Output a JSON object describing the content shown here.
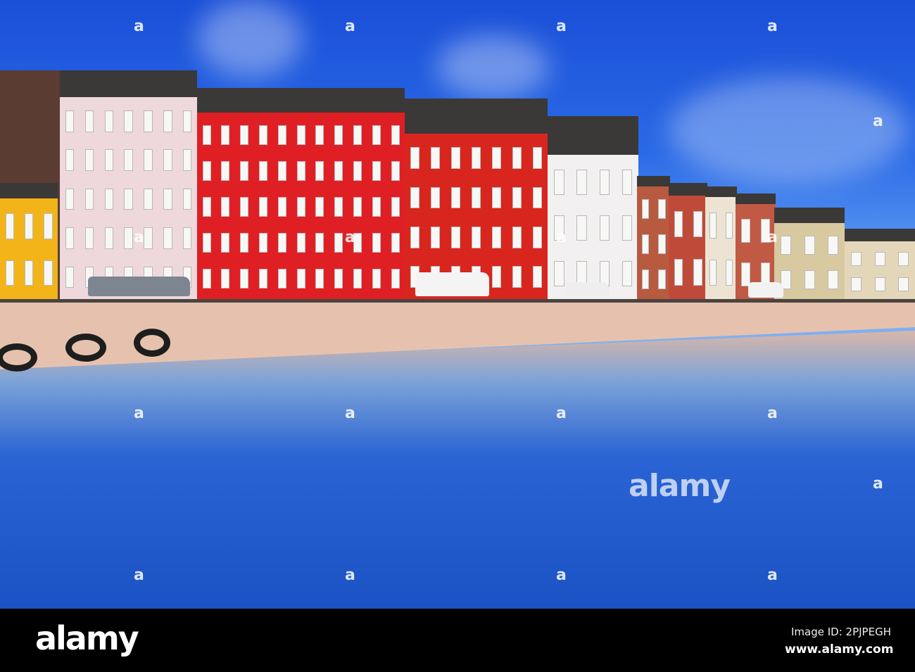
{
  "watermark": {
    "logo": "alamy",
    "center_text": "alamy",
    "tile_mark": "a"
  },
  "footer": {
    "logo": "alamy",
    "image_id": "Image ID: 2PJPEGH",
    "site": "www.alamy.com"
  },
  "colors": {
    "sky": "#1a4fd8",
    "red_facade": "#e01f24",
    "yellow_facade": "#f2b418",
    "water": "#1b52c4"
  }
}
